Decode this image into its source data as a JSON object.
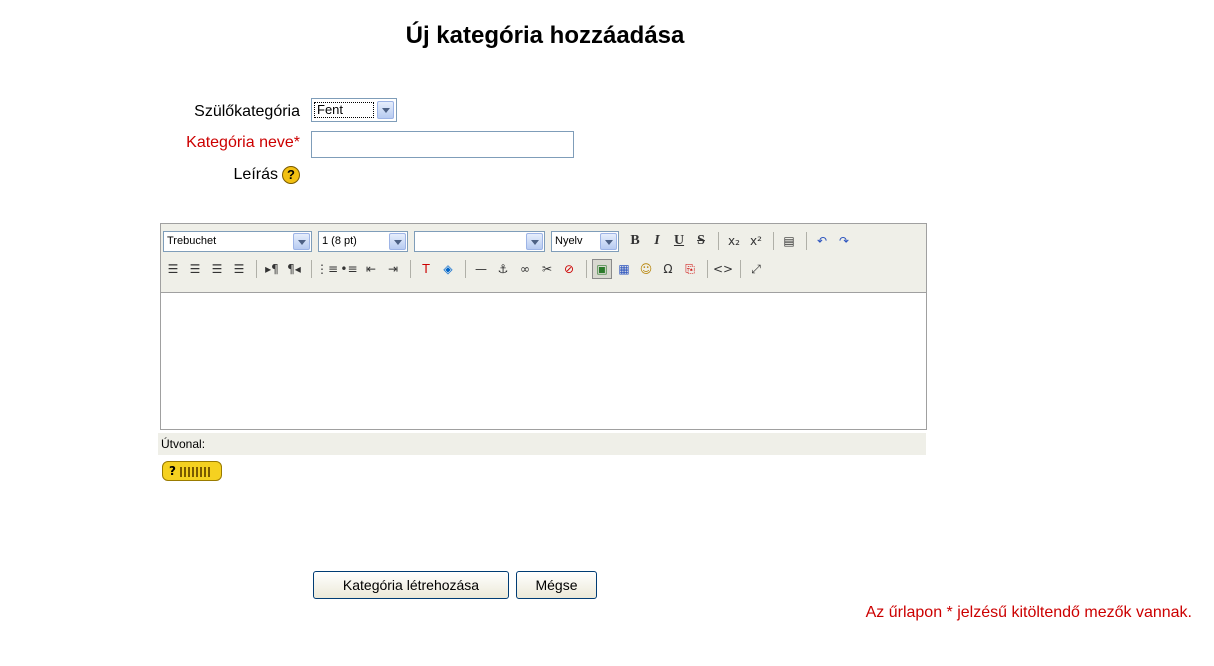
{
  "page": {
    "title": "Új kategória hozzáadása"
  },
  "form": {
    "parent_label": "Szülőkategória",
    "parent_value": "Fent",
    "name_label": "Kategória neve*",
    "name_value": "",
    "desc_label": "Leírás",
    "help_icon": "?"
  },
  "editor": {
    "font_family": "Trebuchet",
    "font_size": "1 (8 pt)",
    "style_value": "",
    "language": "Nyelv",
    "path_label": "Útvonal:",
    "kbd_help": "?",
    "toolbar_row1": [
      "bold-icon",
      "italic-icon",
      "underline-icon",
      "strikethrough-icon",
      "subscript-icon",
      "superscript-icon",
      "paste-word-icon",
      "undo-icon",
      "redo-icon"
    ],
    "toolbar_row2": [
      "align-left-icon",
      "align-center-icon",
      "align-right-icon",
      "justify-icon",
      "ltr-icon",
      "rtl-icon",
      "ordered-list-icon",
      "unordered-list-icon",
      "outdent-icon",
      "indent-icon",
      "text-color-icon",
      "background-color-icon",
      "horizontal-rule-icon",
      "anchor-icon",
      "link-icon",
      "unlink-icon",
      "nolink-icon",
      "insert-image-icon",
      "insert-table-icon",
      "smiley-icon",
      "special-char-icon",
      "search-replace-icon",
      "html-source-icon",
      "fullscreen-icon"
    ]
  },
  "buttons": {
    "create": "Kategória létrehozása",
    "cancel": "Mégse"
  },
  "required_note": "Az űrlapon * jelzésű kitöltendő mezők vannak.",
  "colors": {
    "required": "#cc0000",
    "editor_bg": "#efefe8"
  }
}
